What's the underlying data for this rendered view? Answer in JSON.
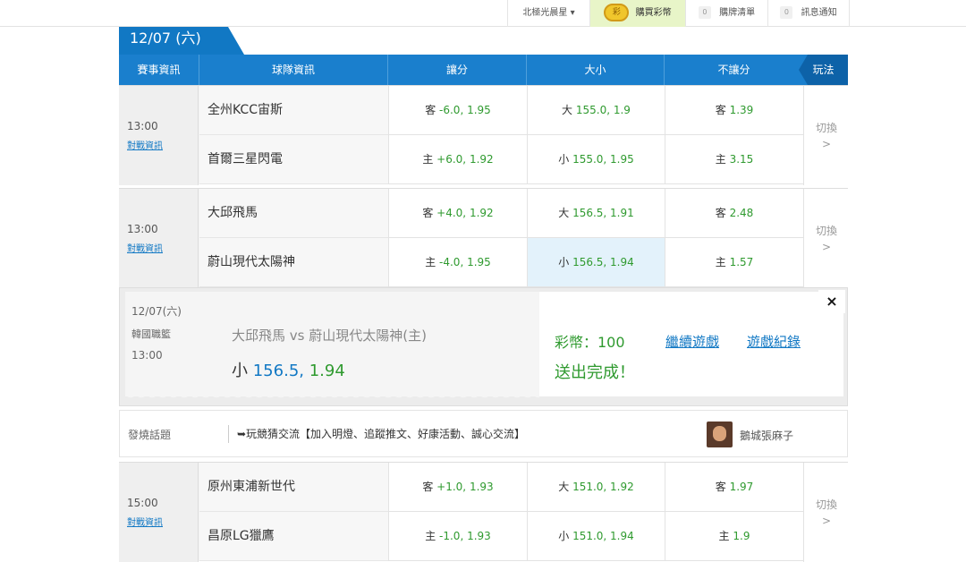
{
  "topbar": {
    "user": "北極光晨星 ▾",
    "coin_icon_text": "彩",
    "buy_label": "購買彩幣",
    "cart_count": "0",
    "cart_label": "購牌清單",
    "msg_count": "0",
    "msg_label": "訊息通知"
  },
  "date_tab": "12/07 (六)",
  "header": {
    "col_event": "賽事資訊",
    "col_team": "球隊資訊",
    "col_spread": "讓分",
    "col_total": "大小",
    "col_ml": "不讓分",
    "play_label": "玩法"
  },
  "matches": [
    {
      "time": "13:00",
      "info": "對戰資訊",
      "away": "全州KCC宙斯",
      "home": "首爾三星閃電",
      "away_spread_tag": "客",
      "away_spread": "-6.0, 1.95",
      "home_spread_tag": "主",
      "home_spread": "+6.0, 1.92",
      "over_tag": "大",
      "over": "155.0, 1.9",
      "under_tag": "小",
      "under": "155.0, 1.95",
      "away_ml_tag": "客",
      "away_ml": "1.39",
      "home_ml_tag": "主",
      "home_ml": "3.15",
      "switch": "切換",
      "switch_arrow": ">"
    },
    {
      "time": "13:00",
      "info": "對戰資訊",
      "away": "大邱飛馬",
      "home": "蔚山現代太陽神",
      "away_spread_tag": "客",
      "away_spread": "+4.0, 1.92",
      "home_spread_tag": "主",
      "home_spread": "-4.0, 1.95",
      "over_tag": "大",
      "over": "156.5, 1.91",
      "under_tag": "小",
      "under": "156.5, 1.94",
      "away_ml_tag": "客",
      "away_ml": "2.48",
      "home_ml_tag": "主",
      "home_ml": "1.57",
      "switch": "切換",
      "switch_arrow": ">"
    },
    {
      "time": "15:00",
      "info": "對戰資訊",
      "away": "原州東浦新世代",
      "home": "昌原LG獵鷹",
      "away_spread_tag": "客",
      "away_spread": "+1.0, 1.93",
      "home_spread_tag": "主",
      "home_spread": "-1.0, 1.93",
      "over_tag": "大",
      "over": "151.0, 1.92",
      "under_tag": "小",
      "under": "151.0, 1.94",
      "away_ml_tag": "客",
      "away_ml": "1.97",
      "home_ml_tag": "主",
      "home_ml": "1.9",
      "switch": "切換",
      "switch_arrow": ">"
    }
  ],
  "popup": {
    "date": "12/07(六)",
    "league": "韓國職籃",
    "time": "13:00",
    "match": "大邱飛馬  vs  蔚山現代太陽神(主)",
    "bet_tag": "小",
    "bet_line": "156.5,",
    "bet_odds": "1.94",
    "coin_text": "彩幣：100",
    "done_text": "送出完成！",
    "continue_link": "繼續遊戲",
    "log_link": "遊戲紀錄",
    "close": "×"
  },
  "topic": {
    "label": "發燒話題",
    "text": "➥玩競猜交流【加入明燈、追蹤推文、好康活動、誠心交流】",
    "user": "鵝城張麻子"
  },
  "colors": {
    "header_blue": "#1a7fcd",
    "odds_green": "#2f9a2f",
    "link_blue": "#1178c4",
    "highlight": "#e3f2fb"
  }
}
